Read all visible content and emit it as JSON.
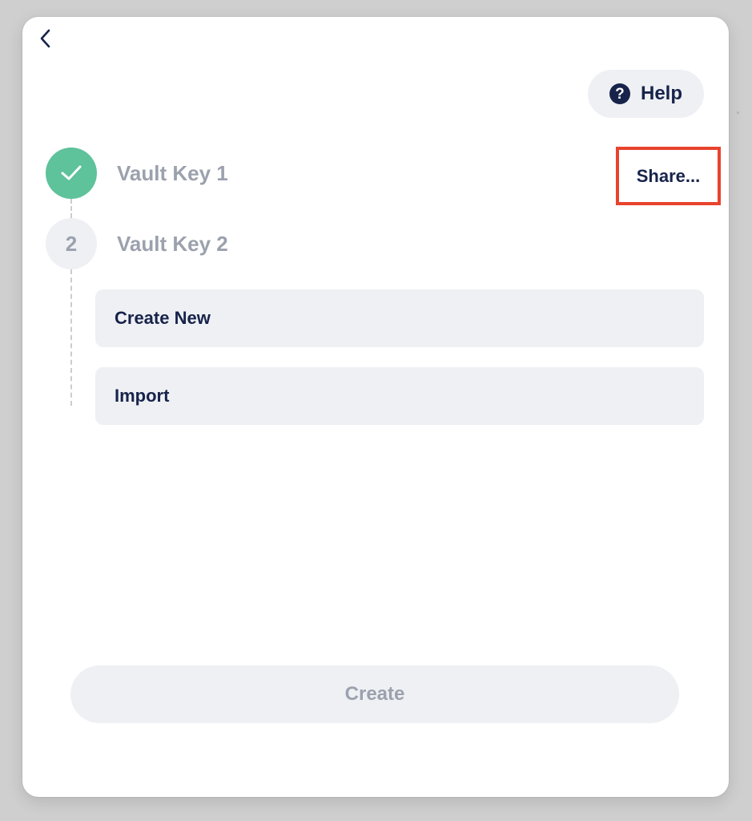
{
  "backdrop": {
    "ghost_text": "."
  },
  "header": {
    "back_icon": "chevron-left-icon",
    "help_label": "Help",
    "help_icon_glyph": "?"
  },
  "steps": [
    {
      "number": "1",
      "label": "Vault Key 1",
      "status": "complete",
      "action_label": "Share..."
    },
    {
      "number": "2",
      "label": "Vault Key 2",
      "status": "pending"
    }
  ],
  "options": {
    "create_new_label": "Create New",
    "import_label": "Import"
  },
  "footer": {
    "create_label": "Create",
    "create_enabled": false
  },
  "colors": {
    "accent_green": "#5ec29b",
    "text_dark": "#17234a",
    "text_muted": "#9ba1ad",
    "button_bg": "#eef0f4",
    "highlight_red": "#e8432c"
  }
}
